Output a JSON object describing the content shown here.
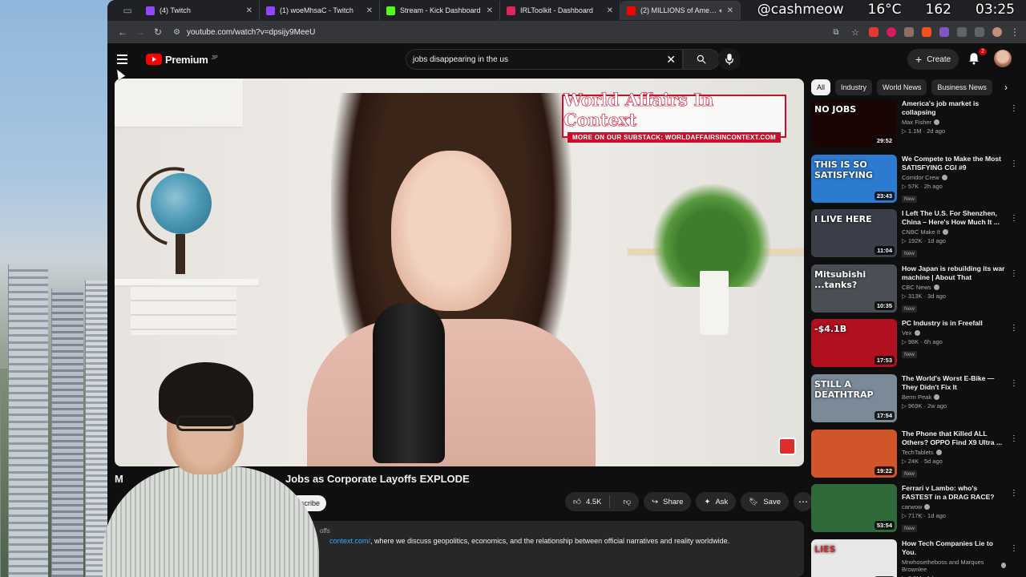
{
  "browser": {
    "tabs": [
      {
        "label": "(4) Twitch",
        "favicon_color": "#9146ff"
      },
      {
        "label": "(1) woeMhsaC - Twitch",
        "favicon_color": "#9146ff"
      },
      {
        "label": "Stream - Kick Dashboard",
        "favicon_color": "#53fc18"
      },
      {
        "label": "IRLToolkit - Dashboard",
        "favicon_color": "#e0245e"
      },
      {
        "label": "(2) MILLIONS of America",
        "favicon_color": "#ff0000",
        "active": true
      }
    ],
    "url": "youtube.com/watch?v=dpsijy9MeeU"
  },
  "overlay": {
    "handle": "@cashmeow",
    "temperature": "16°C",
    "count": "162",
    "clock": "03:25"
  },
  "youtube": {
    "logo_text": "Premium",
    "logo_region": "JP",
    "search_value": "jobs disappearing in the us",
    "create_label": "Create",
    "notification_count": "2"
  },
  "player": {
    "brand_title": "World Affairs In Context",
    "brand_sub": "MORE ON OUR SUBSTACK: WORLDAFFAIRSINCONTEXT.COM"
  },
  "video": {
    "title_prefix": "M",
    "title_visible": "Jobs as Corporate Layoffs EXPLODE",
    "subscribe_label": "bscribe",
    "like_count": "4.5K",
    "share_label": "Share",
    "ask_label": "Ask",
    "save_label": "Save",
    "desc_top": "offs",
    "desc_link": "context.com/",
    "desc_text": ", where we discuss geopolitics, economics, and the relationship between official narratives and reality worldwide."
  },
  "sidebar": {
    "chips": [
      {
        "label": "All",
        "active": true
      },
      {
        "label": "Industry"
      },
      {
        "label": "World News"
      },
      {
        "label": "Business News"
      }
    ],
    "recommendations": [
      {
        "title": "America's job market is collapsing",
        "channel": "Max Fisher",
        "stats": "▷ 1.1M · 2d ago",
        "duration": "29:52",
        "thumb_text": "NO JOBS",
        "thumb_bg": "#1a0505",
        "new": false
      },
      {
        "title": "We Compete to Make the Most SATISFYING CGI #9",
        "channel": "Corridor Crew",
        "stats": "▷ 57K · 2h ago",
        "duration": "23:43",
        "thumb_text": "THIS IS SO SATISFYING",
        "thumb_bg": "#2d7ad1",
        "new": true
      },
      {
        "title": "I Left The U.S. For Shenzhen, China – Here's How Much It ...",
        "channel": "CNBC Make It",
        "stats": "▷ 192K · 1d ago",
        "duration": "11:04",
        "thumb_text": "I LIVE HERE",
        "thumb_bg": "#3a3f4a",
        "new": true
      },
      {
        "title": "How Japan is rebuilding its war machine | About That",
        "channel": "CBC News",
        "stats": "▷ 313K · 3d ago",
        "duration": "10:35",
        "thumb_text": "Mitsubishi ...tanks?",
        "thumb_bg": "#4a4f55",
        "new": true
      },
      {
        "title": "PC Industry is in Freefall",
        "channel": "Vex",
        "stats": "▷ 98K · 6h ago",
        "duration": "17:53",
        "thumb_text": "-$4.1B",
        "thumb_bg": "#b01020",
        "new": true
      },
      {
        "title": "The World's Worst E-Bike — They Didn't Fix It",
        "channel": "Berm Peak",
        "stats": "▷ 969K · 2w ago",
        "duration": "17:54",
        "thumb_text": "STILL A DEATHTRAP",
        "thumb_bg": "#7a8a99",
        "new": false
      },
      {
        "title": "The Phone that Killed ALL Others? OPPO Find X9 Ultra ...",
        "channel": "TechTablets",
        "stats": "▷ 24K · 5d ago",
        "duration": "19:22",
        "thumb_text": "",
        "thumb_bg": "#d0552a",
        "new": true
      },
      {
        "title": "Ferrari v Lambo: who's FASTEST in a DRAG RACE?",
        "channel": "carwow",
        "stats": "▷ 717K · 1d ago",
        "duration": "53:54",
        "thumb_text": "",
        "thumb_bg": "#2f6a3a",
        "new": true
      },
      {
        "title": "How Tech Companies Lie to You.",
        "channel": "Mrwhosetheboss and Marques Brownlee",
        "stats": "▷ 2.5M · 1d ago",
        "duration": "24:47",
        "thumb_text": "LIES",
        "thumb_bg": "#e8e8e8",
        "new": false
      }
    ]
  }
}
